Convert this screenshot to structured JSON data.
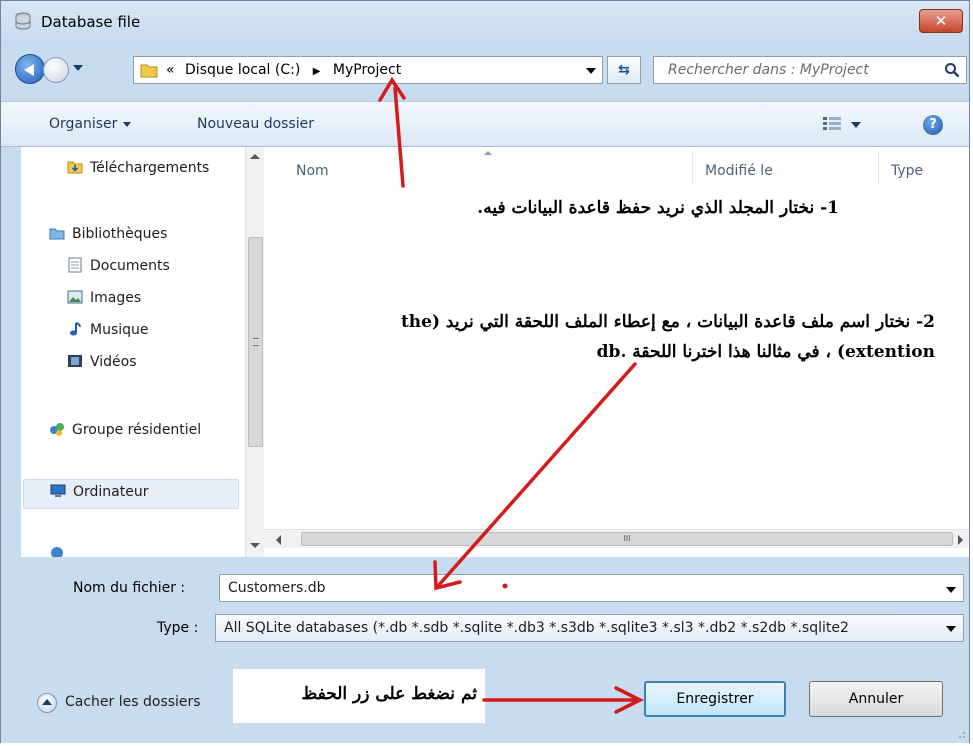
{
  "window": {
    "title": "Database file",
    "close_label": "✕"
  },
  "navbar": {
    "address_prefix": "«",
    "address_parts": [
      "Disque local (C:)",
      "MyProject"
    ],
    "search_placeholder": "Rechercher dans : MyProject"
  },
  "toolbar": {
    "organize_label": "Organiser",
    "new_folder_label": "Nouveau dossier",
    "help_label": "?"
  },
  "nav_pane": {
    "items": [
      {
        "label": "Téléchargements",
        "icon": "downloads-folder-icon"
      },
      {
        "label": "Bibliothèques",
        "icon": "libraries-icon"
      },
      {
        "label": "Documents",
        "icon": "documents-icon"
      },
      {
        "label": "Images",
        "icon": "images-icon"
      },
      {
        "label": "Musique",
        "icon": "music-icon"
      },
      {
        "label": "Vidéos",
        "icon": "videos-icon"
      },
      {
        "label": "Groupe résidentiel",
        "icon": "homegroup-icon"
      },
      {
        "label": "Ordinateur",
        "icon": "computer-icon"
      }
    ]
  },
  "file_pane": {
    "columns": [
      "Nom",
      "Modifié le",
      "Type"
    ],
    "scroll_thumb_label": "III"
  },
  "annotations": {
    "step1": "1- نختار المجلد الذي نريد حفظ قاعدة البيانات فيه.",
    "step2": "2- نختار اسم ملف قاعدة البيانات ، مع إعطاء الملف اللحقة التي نريد (the extention) ، في مثالنا هذا اخترنا اللحقة .db",
    "step3": "ثم نضغط على زر الحفظ"
  },
  "form": {
    "filename_label": "Nom du fichier :",
    "filename_value": "Customers.db",
    "filetype_label": "Type :",
    "filetype_value": "All SQLite databases (*.db *.sdb *.sqlite *.db3 *.s3db *.sqlite3 *.sl3 *.db2 *.s2db *.sqlite2"
  },
  "bottom": {
    "hide_folders_label": "Cacher les dossiers",
    "save_label": "Enregistrer",
    "cancel_label": "Annuler"
  },
  "colors": {
    "window_bg": "#c8dcf0",
    "arrow_red": "#d41b1b",
    "save_border": "#3c7fb1"
  }
}
